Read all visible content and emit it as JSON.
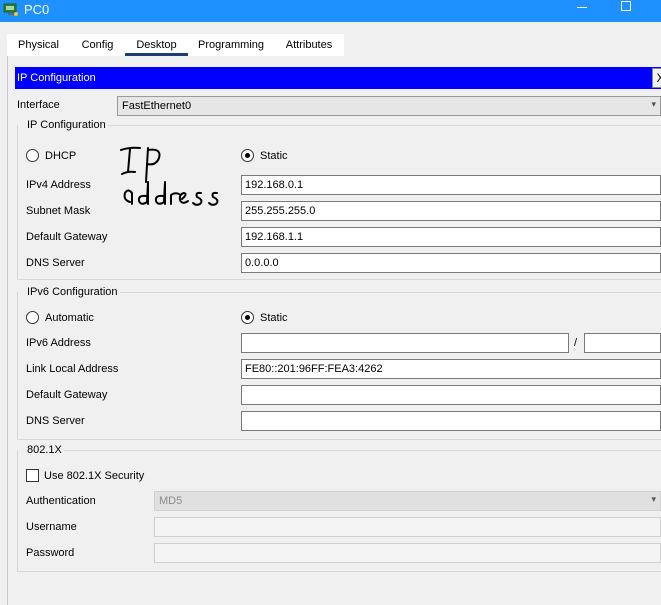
{
  "window": {
    "title": "PC0",
    "icon": "pc-app-icon",
    "accent": "#1e90ff"
  },
  "tabs": [
    {
      "label": "Physical"
    },
    {
      "label": "Config"
    },
    {
      "label": "Desktop",
      "active": true
    },
    {
      "label": "Programming"
    },
    {
      "label": "Attributes"
    }
  ],
  "header": {
    "title": "IP Configuration",
    "close_label": "X",
    "color": "#0000ff"
  },
  "interface": {
    "label": "Interface",
    "value": "FastEthernet0"
  },
  "ipv4": {
    "section_title": "IP Configuration",
    "dhcp_label": "DHCP",
    "static_label": "Static",
    "selected": "Static",
    "address_label": "IPv4 Address",
    "address_value": "192.168.0.1",
    "mask_label": "Subnet Mask",
    "mask_value": "255.255.255.0",
    "gateway_label": "Default Gateway",
    "gateway_value": "192.168.1.1",
    "dns_label": "DNS Server",
    "dns_value": "0.0.0.0"
  },
  "annotation": {
    "handwritten_text": "IP address"
  },
  "ipv6": {
    "section_title": "IPv6 Configuration",
    "automatic_label": "Automatic",
    "static_label": "Static",
    "selected": "Static",
    "address_label": "IPv6 Address",
    "address_value": "",
    "prefix_separator": "/",
    "prefix_value": "",
    "link_local_label": "Link Local Address",
    "link_local_value": "FE80::201:96FF:FEA3:4262",
    "gateway_label": "Default Gateway",
    "gateway_value": "",
    "dns_label": "DNS Server",
    "dns_value": ""
  },
  "dot1x": {
    "section_title": "802.1X",
    "use_security_label": "Use 802.1X Security",
    "use_security_checked": false,
    "auth_label": "Authentication",
    "auth_value": "MD5",
    "username_label": "Username",
    "username_value": "",
    "password_label": "Password",
    "password_value": ""
  }
}
